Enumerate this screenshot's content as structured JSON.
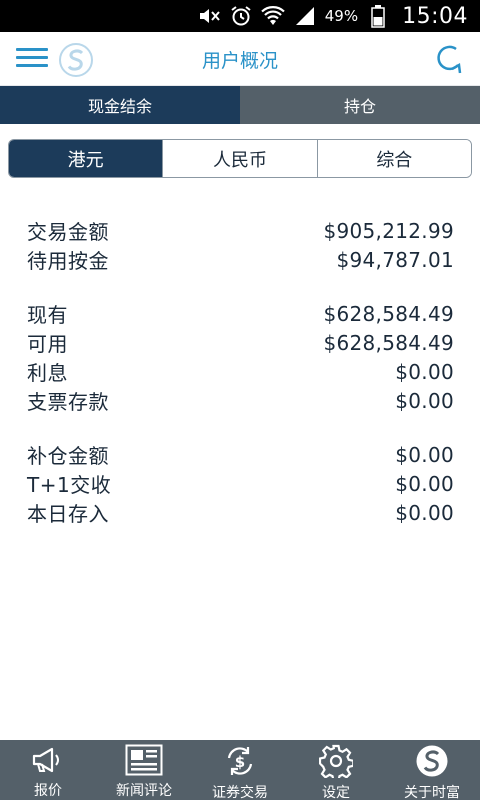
{
  "status_bar": {
    "battery_percent": "49%",
    "time": "15:04",
    "icons": [
      "mute-icon",
      "alarm-icon",
      "wifi-icon",
      "signal-icon",
      "battery-icon"
    ]
  },
  "header": {
    "title": "用户概况",
    "menu_icon": "hamburger-menu-icon",
    "logo_icon": "sunshine-logo-icon",
    "refresh_icon": "refresh-icon",
    "accent_color": "#2a92c8"
  },
  "top_tabs": [
    {
      "label": "现金结余",
      "active": true
    },
    {
      "label": "持仓",
      "active": false
    }
  ],
  "currency_segments": [
    {
      "label": "港元",
      "active": true
    },
    {
      "label": "人民币",
      "active": false
    },
    {
      "label": "综合",
      "active": false
    }
  ],
  "balances": {
    "group1": [
      {
        "label": "交易金额",
        "value": "$905,212.99"
      },
      {
        "label": "待用按金",
        "value": "$94,787.01"
      }
    ],
    "group2": [
      {
        "label": "现有",
        "value": "$628,584.49"
      },
      {
        "label": "可用",
        "value": "$628,584.49"
      },
      {
        "label": "利息",
        "value": "$0.00"
      },
      {
        "label": "支票存款",
        "value": "$0.00"
      }
    ],
    "group3": [
      {
        "label": "补仓金额",
        "value": "$0.00"
      },
      {
        "label": "T+1交收",
        "value": "$0.00"
      },
      {
        "label": "本日存入",
        "value": "$0.00"
      }
    ]
  },
  "bottom_nav": [
    {
      "label": "报价",
      "icon": "megaphone-icon"
    },
    {
      "label": "新闻评论",
      "icon": "newspaper-icon"
    },
    {
      "label": "证券交易",
      "icon": "dollar-exchange-icon"
    },
    {
      "label": "设定",
      "icon": "gear-icon"
    },
    {
      "label": "关于时富",
      "icon": "company-logo-icon"
    }
  ],
  "colors": {
    "primary_dark": "#1c3b5a",
    "tab_inactive": "#546069",
    "nav_background": "#546069"
  }
}
